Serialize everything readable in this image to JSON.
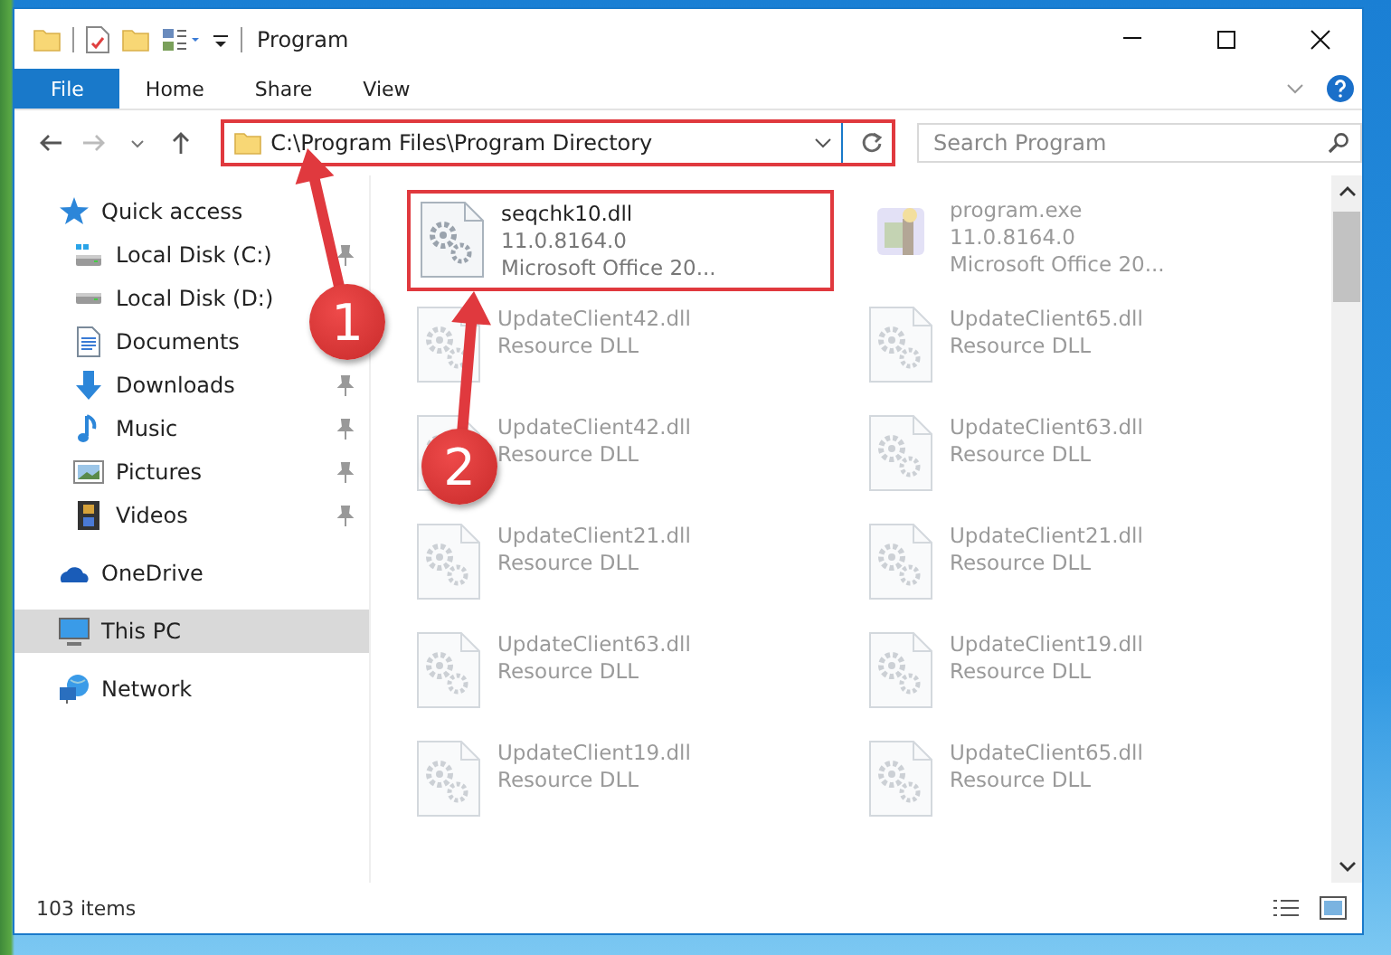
{
  "window": {
    "title": "Program"
  },
  "ribbon": {
    "tabs": [
      {
        "label": "File",
        "selected": true
      },
      {
        "label": "Home",
        "selected": false
      },
      {
        "label": "Share",
        "selected": false
      },
      {
        "label": "View",
        "selected": false
      }
    ]
  },
  "address": {
    "path": "C:\\Program Files\\Program Directory",
    "highlighted": true
  },
  "search": {
    "placeholder": "Search Program"
  },
  "sidebar": {
    "items": [
      {
        "label": "Quick access",
        "kind": "star",
        "pinned": false,
        "selected": false,
        "children": [
          {
            "label": "Local Disk (C:)",
            "kind": "drive-c",
            "pinned": true,
            "selected": false
          },
          {
            "label": "Local Disk (D:)",
            "kind": "drive",
            "pinned": false,
            "selected": false
          },
          {
            "label": "Documents",
            "kind": "documents",
            "pinned": false,
            "selected": false
          },
          {
            "label": "Downloads",
            "kind": "downloads",
            "pinned": true,
            "selected": false
          },
          {
            "label": "Music",
            "kind": "music",
            "pinned": true,
            "selected": false
          },
          {
            "label": "Pictures",
            "kind": "pictures",
            "pinned": true,
            "selected": false
          },
          {
            "label": "Videos",
            "kind": "videos",
            "pinned": true,
            "selected": false
          }
        ]
      },
      {
        "label": "OneDrive",
        "kind": "cloud",
        "pinned": false,
        "selected": false
      },
      {
        "label": "This PC",
        "kind": "pc",
        "pinned": false,
        "selected": true
      },
      {
        "label": "Network",
        "kind": "network",
        "pinned": false,
        "selected": false
      }
    ]
  },
  "files": [
    {
      "name": "seqchk10.dll",
      "details": [
        "11.0.8164.0",
        "Microsoft Office 20..."
      ],
      "kind": "dll",
      "blurred": false,
      "highlighted": true
    },
    {
      "name": "program.exe",
      "details": [
        "11.0.8164.0",
        "Microsoft Office 20..."
      ],
      "kind": "exe",
      "blurred": true,
      "highlighted": false
    },
    {
      "name": "UpdateClient42.dll",
      "details": [
        "Resource DLL"
      ],
      "kind": "dll",
      "blurred": true,
      "highlighted": false
    },
    {
      "name": "UpdateClient65.dll",
      "details": [
        "Resource DLL"
      ],
      "kind": "dll",
      "blurred": true,
      "highlighted": false
    },
    {
      "name": "UpdateClient42.dll",
      "details": [
        "Resource DLL"
      ],
      "kind": "dll",
      "blurred": true,
      "highlighted": false
    },
    {
      "name": "UpdateClient63.dll",
      "details": [
        "Resource DLL"
      ],
      "kind": "dll",
      "blurred": true,
      "highlighted": false
    },
    {
      "name": "UpdateClient21.dll",
      "details": [
        "Resource DLL"
      ],
      "kind": "dll",
      "blurred": true,
      "highlighted": false
    },
    {
      "name": "UpdateClient21.dll",
      "details": [
        "Resource DLL"
      ],
      "kind": "dll",
      "blurred": true,
      "highlighted": false
    },
    {
      "name": "UpdateClient63.dll",
      "details": [
        "Resource DLL"
      ],
      "kind": "dll",
      "blurred": true,
      "highlighted": false
    },
    {
      "name": "UpdateClient19.dll",
      "details": [
        "Resource DLL"
      ],
      "kind": "dll",
      "blurred": true,
      "highlighted": false
    },
    {
      "name": "UpdateClient19.dll",
      "details": [
        "Resource DLL"
      ],
      "kind": "dll",
      "blurred": true,
      "highlighted": false
    },
    {
      "name": "UpdateClient65.dll",
      "details": [
        "Resource DLL"
      ],
      "kind": "dll",
      "blurred": true,
      "highlighted": false
    }
  ],
  "annotations": [
    {
      "number": "1"
    },
    {
      "number": "2"
    }
  ],
  "status_bar": {
    "item_count": "103 items"
  }
}
